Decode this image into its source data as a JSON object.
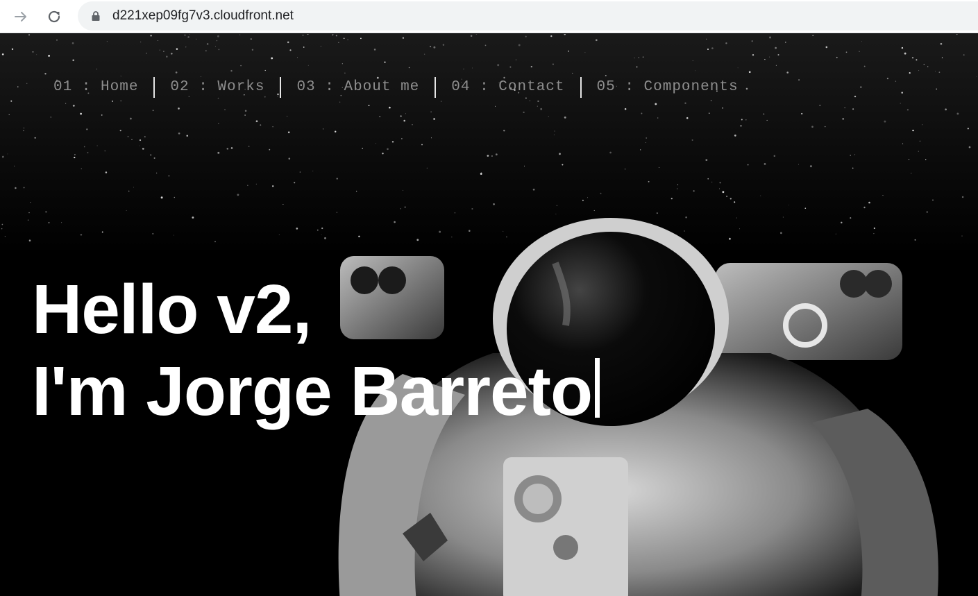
{
  "browser": {
    "url": "d221xep09fg7v3.cloudfront.net"
  },
  "nav": {
    "items": [
      {
        "label": "01 : Home"
      },
      {
        "label": "02 : Works"
      },
      {
        "label": "03 : About me"
      },
      {
        "label": "04 : Contact"
      },
      {
        "label": "05 : Components"
      }
    ]
  },
  "hero": {
    "line1": "Hello v2,",
    "line2": "I'm Jorge Barreto"
  },
  "colors": {
    "background": "#000000",
    "nav_text": "#8e8e8e",
    "hero_text": "#ffffff"
  },
  "icons": [
    "arrow-forward-icon",
    "reload-icon",
    "lock-icon",
    "typing-cursor"
  ]
}
